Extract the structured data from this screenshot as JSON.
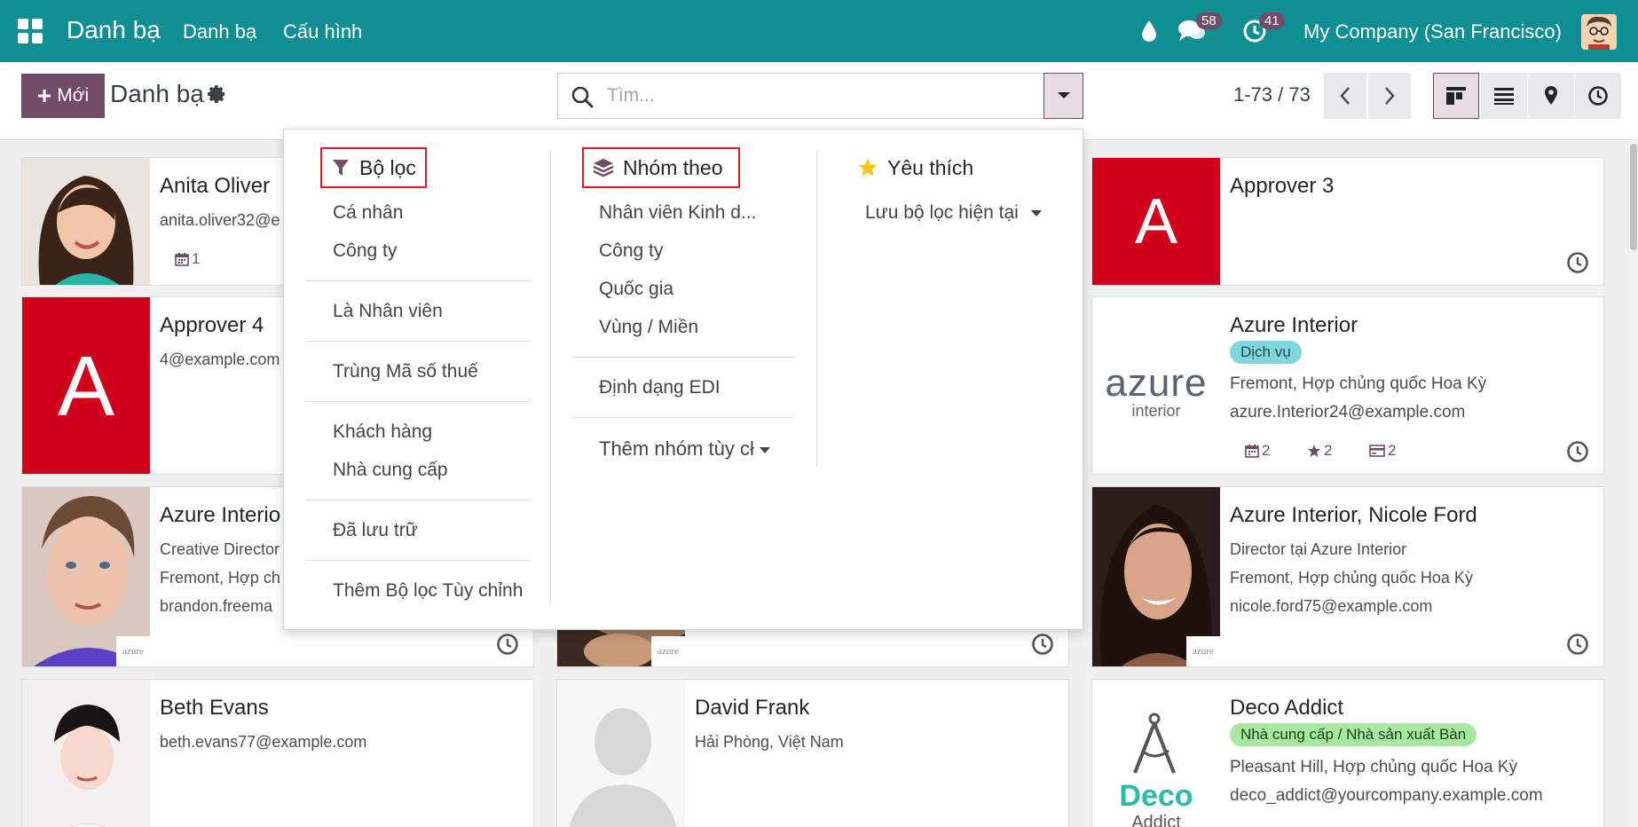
{
  "navbar": {
    "brand": "Danh bạ",
    "menus": [
      "Danh bạ",
      "Cấu hình"
    ],
    "messages_count": "58",
    "activities_count": "41",
    "company": "My Company (San Francisco)"
  },
  "control_panel": {
    "new_label": "Mới",
    "title": "Danh bạ",
    "search_placeholder": "Tìm...",
    "pager": "1-73 / 73"
  },
  "filter_menu": {
    "filters": {
      "heading": "Bộ lọc",
      "items": [
        "Cá nhân",
        "Công ty",
        "Là Nhân viên",
        "Trùng Mã số thuế",
        "Khách hàng",
        "Nhà cung cấp",
        "Đã lưu trữ",
        "Thêm Bộ lọc Tùy chỉnh"
      ]
    },
    "group_by": {
      "heading": "Nhóm theo",
      "items": [
        "Nhân viên Kinh d...",
        "Công ty",
        "Quốc gia",
        "Vùng / Miền",
        "Định dạng EDI",
        "Thêm nhóm tùy cł"
      ]
    },
    "favorites": {
      "heading": "Yêu thích",
      "items": [
        "Lưu bộ lọc hiện tại"
      ]
    }
  },
  "cards": [
    {
      "name": "Anita Oliver",
      "lines": [
        "anita.oliver32@e"
      ],
      "meeting_count": "1"
    },
    {
      "name": "Approver 3",
      "initial": "A"
    },
    {
      "name": "Approver 4",
      "initial": "A",
      "lines": [
        "4@example.com"
      ]
    },
    {
      "name": "Azure Interior",
      "tag": "Dịch vụ",
      "lines": [
        "Fremont, Hợp chủng quốc Hoa Kỳ",
        "azure.Interior24@example.com"
      ],
      "logo_text": "azure",
      "logo_sub": "interior",
      "counts": [
        "2",
        "2",
        "2"
      ]
    },
    {
      "name": "Azure Interio",
      "lines": [
        "Creative Director",
        "Fremont, Hợp ch",
        "brandon.freema"
      ],
      "badge": "azure"
    },
    {
      "badge": "azure"
    },
    {
      "name": "Azure Interior, Nicole Ford",
      "lines": [
        "Director tại Azure Interior",
        "Fremont, Hợp chủng quốc Hoa Kỳ",
        "nicole.ford75@example.com"
      ],
      "badge": "azure"
    },
    {
      "name": "Beth Evans",
      "lines": [
        "beth.evans77@example.com"
      ]
    },
    {
      "name": "David Frank",
      "lines": [
        "Hải Phòng, Việt Nam"
      ]
    },
    {
      "name": "Deco Addict",
      "tag": "Nhà cung cấp / Nhà sản xuất Bàn",
      "lines": [
        "Pleasant Hill, Hợp chủng quốc Hoa Kỳ",
        "deco_addict@yourcompany.example.com"
      ],
      "logo_text": "Deco",
      "logo_sub": "Addict"
    }
  ],
  "colors": {
    "navbar": "#108e92",
    "primary": "#714b67",
    "initial_bg": "#d0021b",
    "tag_service": "#7fd7dc",
    "tag_vendor": "#a7e8a0",
    "highlight_box": "#e01b24",
    "star": "#f5c518"
  }
}
